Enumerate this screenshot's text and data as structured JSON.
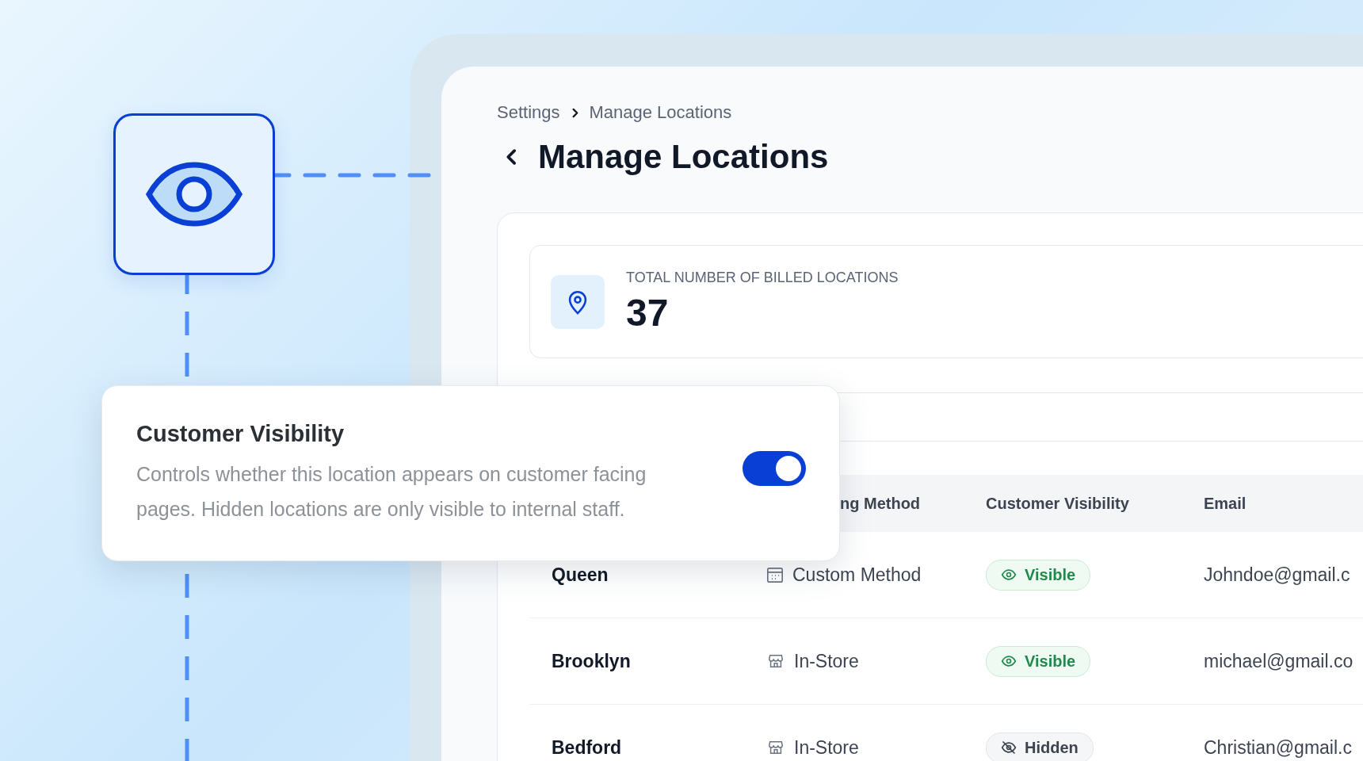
{
  "breadcrumb": [
    {
      "label": "Settings"
    },
    {
      "label": "Manage Locations"
    }
  ],
  "title": "Manage Locations",
  "stat": {
    "label": "TOTAL NUMBER OF BILLED LOCATIONS",
    "value": "37"
  },
  "table": {
    "columns": [
      "ng Method",
      "Customer Visibility",
      "Email"
    ],
    "rows": [
      {
        "name": "Queen",
        "method": "Custom Method",
        "kind": "calendar",
        "visibility": "Visible",
        "visible": true,
        "email": "Johndoe@gmail.c"
      },
      {
        "name": "Brooklyn",
        "method": "In-Store",
        "kind": "store",
        "visibility": "Visible",
        "visible": true,
        "email": "michael@gmail.co"
      },
      {
        "name": "Bedford",
        "method": "In-Store",
        "kind": "store",
        "visibility": "Hidden",
        "visible": false,
        "email": "Christian@gmail.c"
      }
    ]
  },
  "popup": {
    "title": "Customer Visibility",
    "description": "Controls whether this location appears on customer facing pages. Hidden locations are only visible to internal staff.",
    "on": true
  }
}
